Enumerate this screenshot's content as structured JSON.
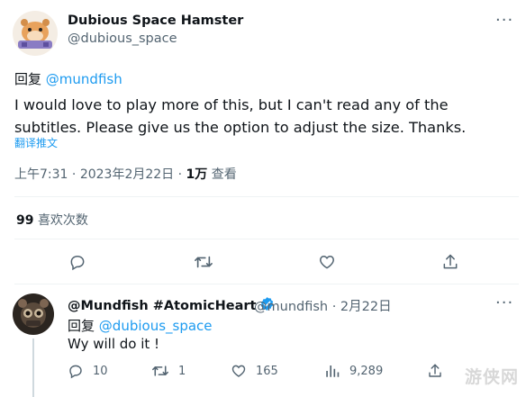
{
  "main_tweet": {
    "author_name": "Dubious Space Hamster",
    "author_handle": "@dubious_space",
    "more_icon": "more-dots-icon",
    "reply_prefix": "回复",
    "reply_to": "@mundfish",
    "text": "I would love to play more of this, but I can't read any of the subtitles. Please give us the option to adjust the size. Thanks.",
    "translate_label": "翻译推文",
    "time": "上午7:31",
    "date": "2023年2月22日",
    "separator": "·",
    "views_count": "1万",
    "views_label": "查看",
    "likes_count": "99",
    "likes_label": "喜欢次数",
    "actions": {
      "reply_icon": "reply-icon",
      "retweet_icon": "retweet-icon",
      "like_icon": "heart-icon",
      "share_icon": "share-icon"
    }
  },
  "reply_tweet": {
    "author_name": "@Mundfish #AtomicHeart",
    "verified_icon": "verified-badge-icon",
    "author_handle": "@mundfish",
    "separator": "·",
    "date": "2月22日",
    "more_icon": "more-dots-icon",
    "reply_prefix": "回复",
    "reply_to": "@dubious_space",
    "text": "Wy will do it !",
    "actions": {
      "reply_count": "10",
      "retweet_count": "1",
      "like_count": "165",
      "views_count": "9,289"
    }
  },
  "watermark": "游侠网",
  "colors": {
    "link": "#1d9bf0",
    "secondary_text": "#536471",
    "primary_text": "#0f1419",
    "divider": "#eff3f4"
  }
}
